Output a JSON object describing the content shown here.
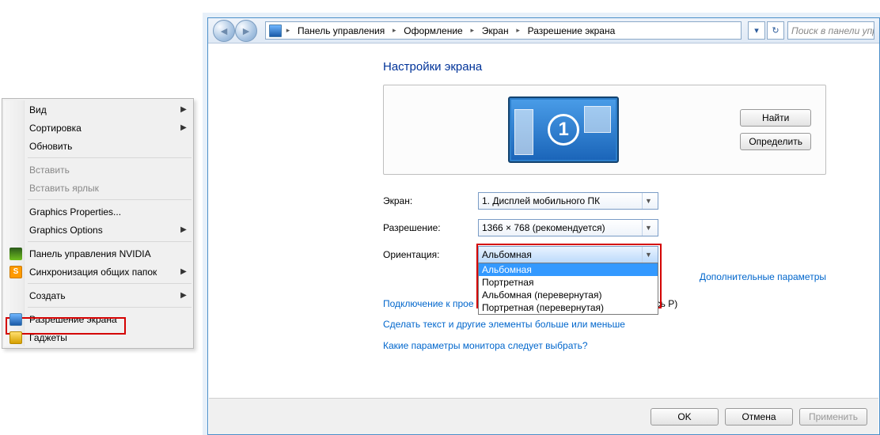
{
  "context_menu": {
    "items": [
      {
        "label": "Вид",
        "submenu": true
      },
      {
        "label": "Сортировка",
        "submenu": true
      },
      {
        "label": "Обновить"
      },
      {
        "sep": true
      },
      {
        "label": "Вставить",
        "disabled": true
      },
      {
        "label": "Вставить ярлык",
        "disabled": true
      },
      {
        "sep": true
      },
      {
        "label": "Graphics Properties..."
      },
      {
        "label": "Graphics Options",
        "submenu": true
      },
      {
        "sep": true
      },
      {
        "label": "Панель управления NVIDIA",
        "icon": "nvidia"
      },
      {
        "label": "Синхронизация общих папок",
        "icon": "sync",
        "submenu": true
      },
      {
        "sep": true
      },
      {
        "label": "Создать",
        "submenu": true
      },
      {
        "sep": true
      },
      {
        "label": "Разрешение экрана",
        "icon": "disp",
        "highlight": true
      },
      {
        "label": "Гаджеты",
        "icon": "gadget"
      }
    ]
  },
  "breadcrumb": {
    "items": [
      "Панель управления",
      "Оформление",
      "Экран",
      "Разрешение экрана"
    ]
  },
  "search_placeholder": "Поиск в панели упр",
  "page": {
    "title": "Настройки экрана",
    "find_btn": "Найти",
    "detect_btn": "Определить",
    "monitor_number": "1",
    "screen_label": "Экран:",
    "screen_value": "1. Дисплей мобильного ПК",
    "res_label": "Разрешение:",
    "res_value": "1366 × 768 (рекомендуется)",
    "orient_label": "Ориентация:",
    "orient_value": "Альбомная",
    "orient_options": [
      "Альбомная",
      "Портретная",
      "Альбомная (перевернутая)",
      "Портретная (перевернутая)"
    ],
    "extra_params": "Дополнительные параметры",
    "proj_text_prefix": "Подключение к прое",
    "proj_text_suffix": "и коснитесь P)",
    "text_link": "Сделать текст и другие элементы больше или меньше",
    "monitor_link": "Какие параметры монитора следует выбрать?"
  },
  "footer": {
    "ok": "OK",
    "cancel": "Отмена",
    "apply": "Применить"
  }
}
